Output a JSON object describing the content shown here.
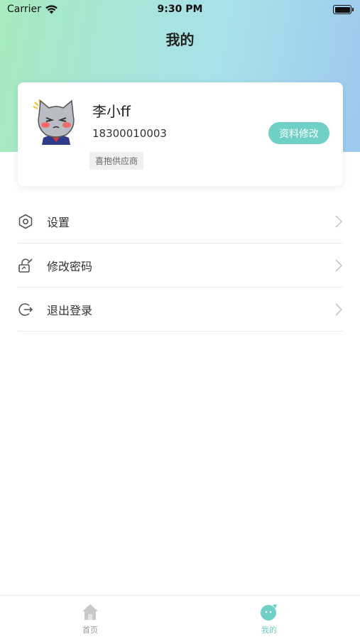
{
  "status_bar": {
    "carrier": "Carrier",
    "time": "9:30 PM"
  },
  "header": {
    "title": "我的"
  },
  "profile": {
    "name": "李小ff",
    "phone": "18300010003",
    "tag": "喜抱供应商",
    "edit_label": "资料修改"
  },
  "menu": {
    "items": [
      {
        "label": "设置",
        "icon": "hexagon-settings-icon"
      },
      {
        "label": "修改密码",
        "icon": "lock-edit-icon"
      },
      {
        "label": "退出登录",
        "icon": "logout-icon"
      }
    ]
  },
  "tabbar": {
    "tabs": [
      {
        "label": "首页",
        "icon": "home-icon",
        "active": false
      },
      {
        "label": "我的",
        "icon": "profile-face-icon",
        "active": true
      }
    ]
  },
  "colors": {
    "accent": "#6fd0c6",
    "tab_inactive": "#999999",
    "gradient_start": "#a6eabd",
    "gradient_end": "#9cc9ee"
  }
}
